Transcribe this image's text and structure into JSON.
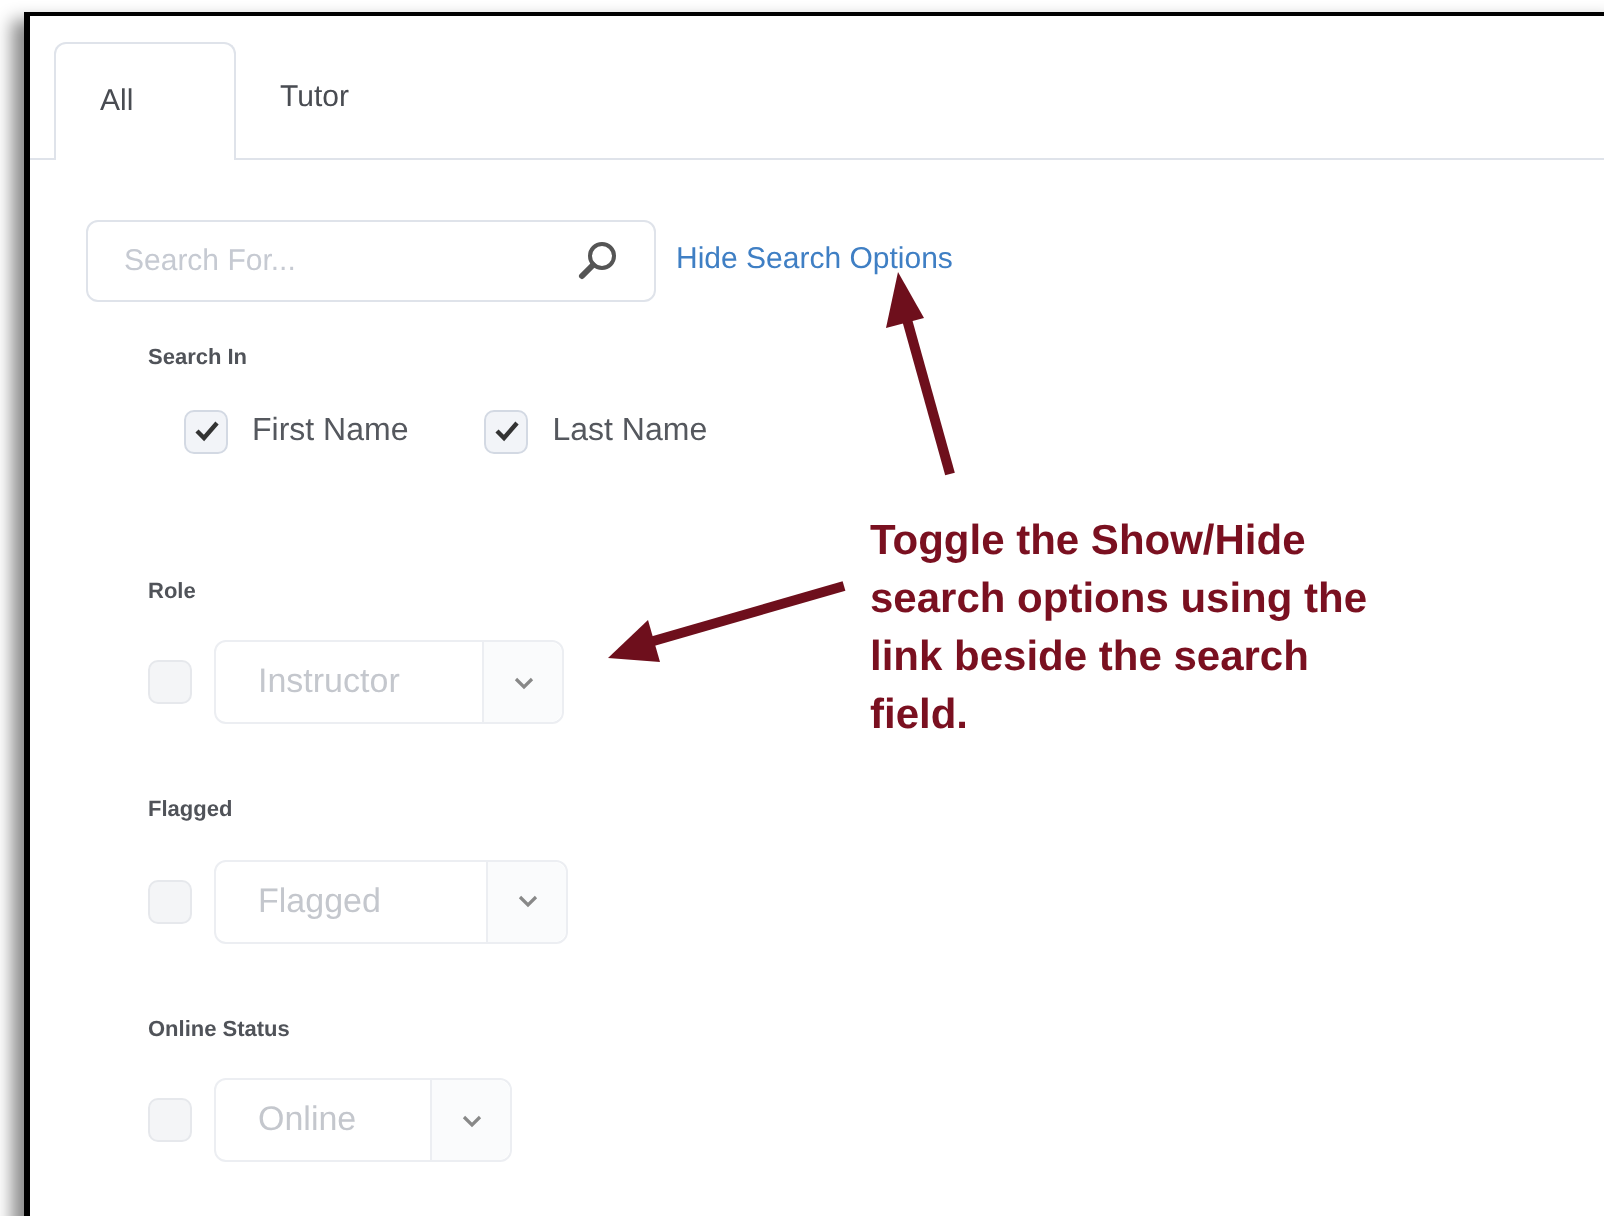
{
  "tabs": [
    {
      "label": "All",
      "selected": true
    },
    {
      "label": "Tutor",
      "selected": false
    }
  ],
  "search": {
    "placeholder": "Search For...",
    "toggle_link": "Hide Search Options"
  },
  "search_in": {
    "label": "Search In",
    "options": [
      {
        "label": "First Name",
        "checked": true
      },
      {
        "label": "Last Name",
        "checked": true
      }
    ]
  },
  "filters": [
    {
      "label": "Role",
      "checked": false,
      "value": "Instructor"
    },
    {
      "label": "Flagged",
      "checked": false,
      "value": "Flagged"
    },
    {
      "label": "Online Status",
      "checked": false,
      "value": "Online"
    }
  ],
  "annotation": "Toggle the Show/Hide search options using the link beside the search field."
}
